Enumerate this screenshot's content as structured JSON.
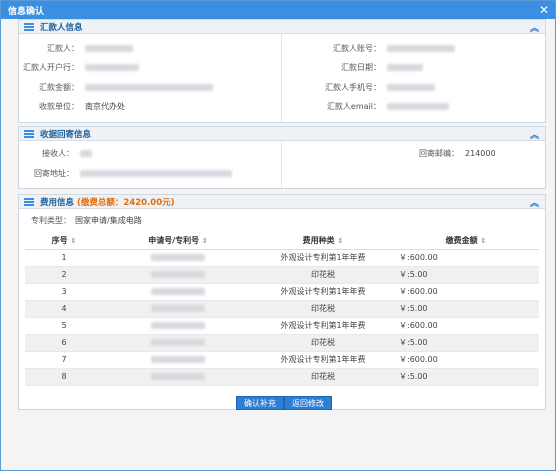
{
  "dialog": {
    "title": "信息确认"
  },
  "remitter": {
    "title": "汇款人信息",
    "labels": {
      "name": "汇款人：",
      "bank": "汇款人开户行：",
      "amount": "汇款金额：",
      "payee": "收款单位：",
      "account": "汇款人账号：",
      "date": "汇款日期：",
      "phone": "汇款人手机号：",
      "email": "汇款人email："
    },
    "payee_value": "南京代办处"
  },
  "receipt": {
    "title": "收据回寄信息",
    "labels": {
      "receiver": "接收人：",
      "address": "回寄地址：",
      "postcode": "回寄邮编："
    },
    "postcode_value": "214000"
  },
  "fees": {
    "title": "费用信息",
    "total_text": "(缴费总额：2420.00元)",
    "patent_type_label": "专利类型：",
    "patent_type_value": "国家申请/集成电路",
    "columns": [
      "序号",
      "申请号/专利号",
      "费用种类",
      "缴费金额"
    ],
    "rows": [
      {
        "no": "1",
        "type": "外观设计专利第1年年费",
        "amount": "￥:600.00"
      },
      {
        "no": "2",
        "type": "印花税",
        "amount": "￥:5.00"
      },
      {
        "no": "3",
        "type": "外观设计专利第1年年费",
        "amount": "￥:600.00"
      },
      {
        "no": "4",
        "type": "印花税",
        "amount": "￥:5.00"
      },
      {
        "no": "5",
        "type": "外观设计专利第1年年费",
        "amount": "￥:600.00"
      },
      {
        "no": "6",
        "type": "印花税",
        "amount": "￥:5.00"
      },
      {
        "no": "7",
        "type": "外观设计专利第1年年费",
        "amount": "￥:600.00"
      },
      {
        "no": "8",
        "type": "印花税",
        "amount": "￥:5.00"
      }
    ]
  },
  "buttons": {
    "confirm": "确认补充",
    "back": "返回修改"
  }
}
